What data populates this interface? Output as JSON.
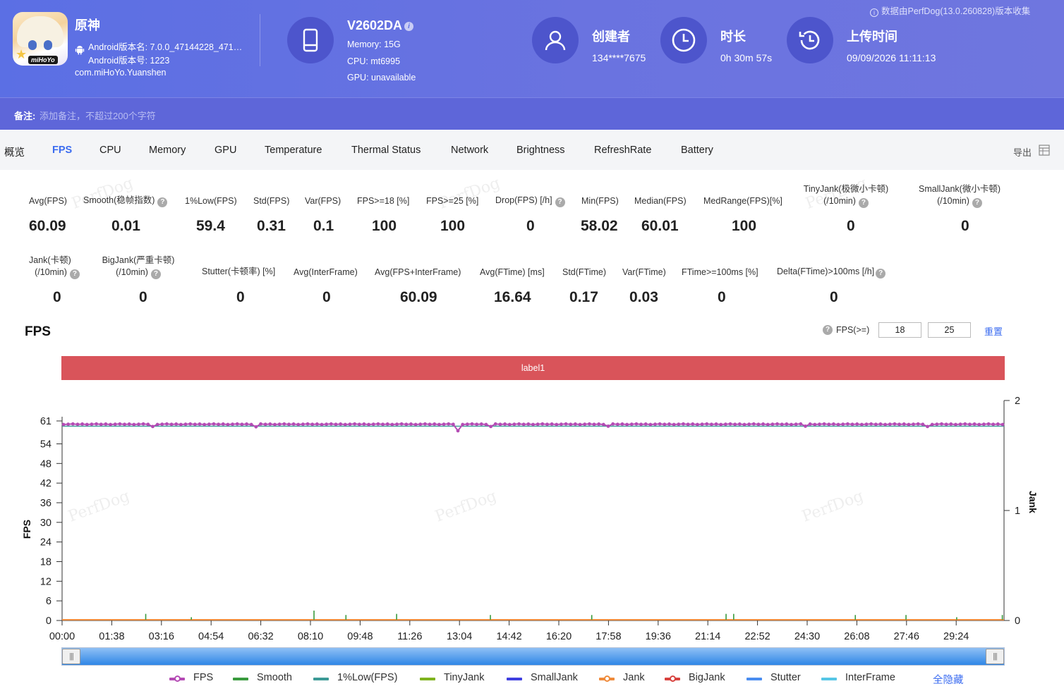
{
  "header": {
    "app_name": "原神",
    "app_icon_brand": "miHoYo",
    "version_name": "Android版本名: 7.0.0_47144228_471…",
    "version_code": "Android版本号: 1223",
    "package": "com.miHoYo.Yuanshen",
    "device_name": "V2602DA",
    "device_memory": "Memory: 15G",
    "device_cpu": "CPU: mt6995",
    "device_gpu": "GPU: unavailable",
    "creator_label": "创建者",
    "creator_value": "134****7675",
    "duration_label": "时长",
    "duration_value": "0h 30m 57s",
    "upload_label": "上传时间",
    "upload_value": "09/09/2026 11:11:13",
    "collect_note": "数据由PerfDog(13.0.260828)版本收集"
  },
  "note": {
    "label": "备注:",
    "placeholder": "添加备注，不超过200个字符"
  },
  "tabs": [
    "概览",
    "FPS",
    "CPU",
    "Memory",
    "GPU",
    "Temperature",
    "Thermal Status",
    "Network",
    "Brightness",
    "RefreshRate",
    "Battery"
  ],
  "active_tab": "FPS",
  "export_label": "导出",
  "metrics_row1": [
    {
      "label": "Avg(FPS)",
      "value": "60.09"
    },
    {
      "label": "Smooth(稳帧指数)",
      "value": "0.01",
      "help": true
    },
    {
      "label": "1%Low(FPS)",
      "value": "59.4"
    },
    {
      "label": "Std(FPS)",
      "value": "0.31"
    },
    {
      "label": "Var(FPS)",
      "value": "0.1"
    },
    {
      "label": "FPS>=18 [%]",
      "value": "100"
    },
    {
      "label": "FPS>=25 [%]",
      "value": "100"
    },
    {
      "label": "Drop(FPS) [/h]",
      "value": "0",
      "help": true
    },
    {
      "label": "Min(FPS)",
      "value": "58.02"
    },
    {
      "label": "Median(FPS)",
      "value": "60.01"
    },
    {
      "label": "MedRange(FPS)[%]",
      "value": "100"
    },
    {
      "label": "TinyJank(极微小卡顿)",
      "label2": "(/10min)",
      "value": "0",
      "help": true
    },
    {
      "label": "SmallJank(微小卡顿)",
      "label2": "(/10min)",
      "value": "0",
      "help": true
    }
  ],
  "metrics_row2": [
    {
      "label": "Jank(卡顿)",
      "label2": "(/10min)",
      "value": "0",
      "help": true
    },
    {
      "label": "BigJank(严重卡顿)",
      "label2": "(/10min)",
      "value": "0",
      "help": true
    },
    {
      "label": "Stutter(卡顿率) [%]",
      "value": "0"
    },
    {
      "label": "Avg(InterFrame)",
      "value": "0"
    },
    {
      "label": "Avg(FPS+InterFrame)",
      "value": "60.09"
    },
    {
      "label": "Avg(FTime) [ms]",
      "value": "16.64"
    },
    {
      "label": "Std(FTime)",
      "value": "0.17"
    },
    {
      "label": "Var(FTime)",
      "value": "0.03"
    },
    {
      "label": "FTime>=100ms [%]",
      "value": "0"
    },
    {
      "label": "Delta(FTime)>100ms [/h]",
      "value": "0",
      "help": true
    }
  ],
  "watermark": "PerfDog",
  "chart_section": {
    "title": "FPS",
    "threshold_label": "FPS(>=)",
    "threshold_1": "18",
    "threshold_2": "25",
    "reset_label": "重置",
    "band_label": "label1"
  },
  "chart_data": {
    "type": "line",
    "ylabel": "FPS",
    "y2label": "Jank",
    "yticks": [
      0,
      6,
      12,
      18,
      24,
      30,
      36,
      42,
      48,
      54,
      61
    ],
    "ylim": [
      0,
      61
    ],
    "y2ticks": [
      0,
      1,
      2
    ],
    "y2lim": [
      0,
      2
    ],
    "xticks": [
      "00:00",
      "01:38",
      "03:16",
      "04:54",
      "06:32",
      "08:10",
      "09:48",
      "11:26",
      "13:04",
      "14:42",
      "16:20",
      "17:58",
      "19:36",
      "21:14",
      "22:52",
      "24:30",
      "26:08",
      "27:46",
      "29:24"
    ],
    "duration_seconds": 1857,
    "series": [
      {
        "name": "FPS",
        "color": "#b44bb4",
        "approx_value": 60.0,
        "dips": [
          [
            180,
            59.3
          ],
          [
            378,
            59.2
          ],
          [
            780,
            58.0
          ],
          [
            842,
            59.3
          ],
          [
            1078,
            59.4
          ],
          [
            1468,
            59.4
          ],
          [
            1705,
            59.3
          ]
        ]
      },
      {
        "name": "Smooth",
        "color": "#3a9b3e"
      },
      {
        "name": "1%Low(FPS)",
        "color": "#3c9a96",
        "approx_value": 59.4
      },
      {
        "name": "TinyJank",
        "color": "#7fb31e"
      },
      {
        "name": "SmallJank",
        "color": "#3f3fe0"
      },
      {
        "name": "Jank",
        "color": "#ef8a3a"
      },
      {
        "name": "BigJank",
        "color": "#d8423e"
      },
      {
        "name": "Stutter",
        "color": "#4a8df0"
      },
      {
        "name": "InterFrame",
        "color": "#56c6e6"
      }
    ],
    "smooth_spikes": [
      [
        165,
        0.06
      ],
      [
        255,
        0.03
      ],
      [
        497,
        0.09
      ],
      [
        560,
        0.05
      ],
      [
        660,
        0.06
      ],
      [
        845,
        0.05
      ],
      [
        1045,
        0.05
      ],
      [
        1045,
        0.04
      ],
      [
        1310,
        0.06
      ],
      [
        1325,
        0.06
      ],
      [
        1565,
        0.05
      ],
      [
        1665,
        0.05
      ],
      [
        1765,
        0.03
      ],
      [
        1855,
        0.05
      ]
    ],
    "legend_hide_all": "全隐藏"
  }
}
